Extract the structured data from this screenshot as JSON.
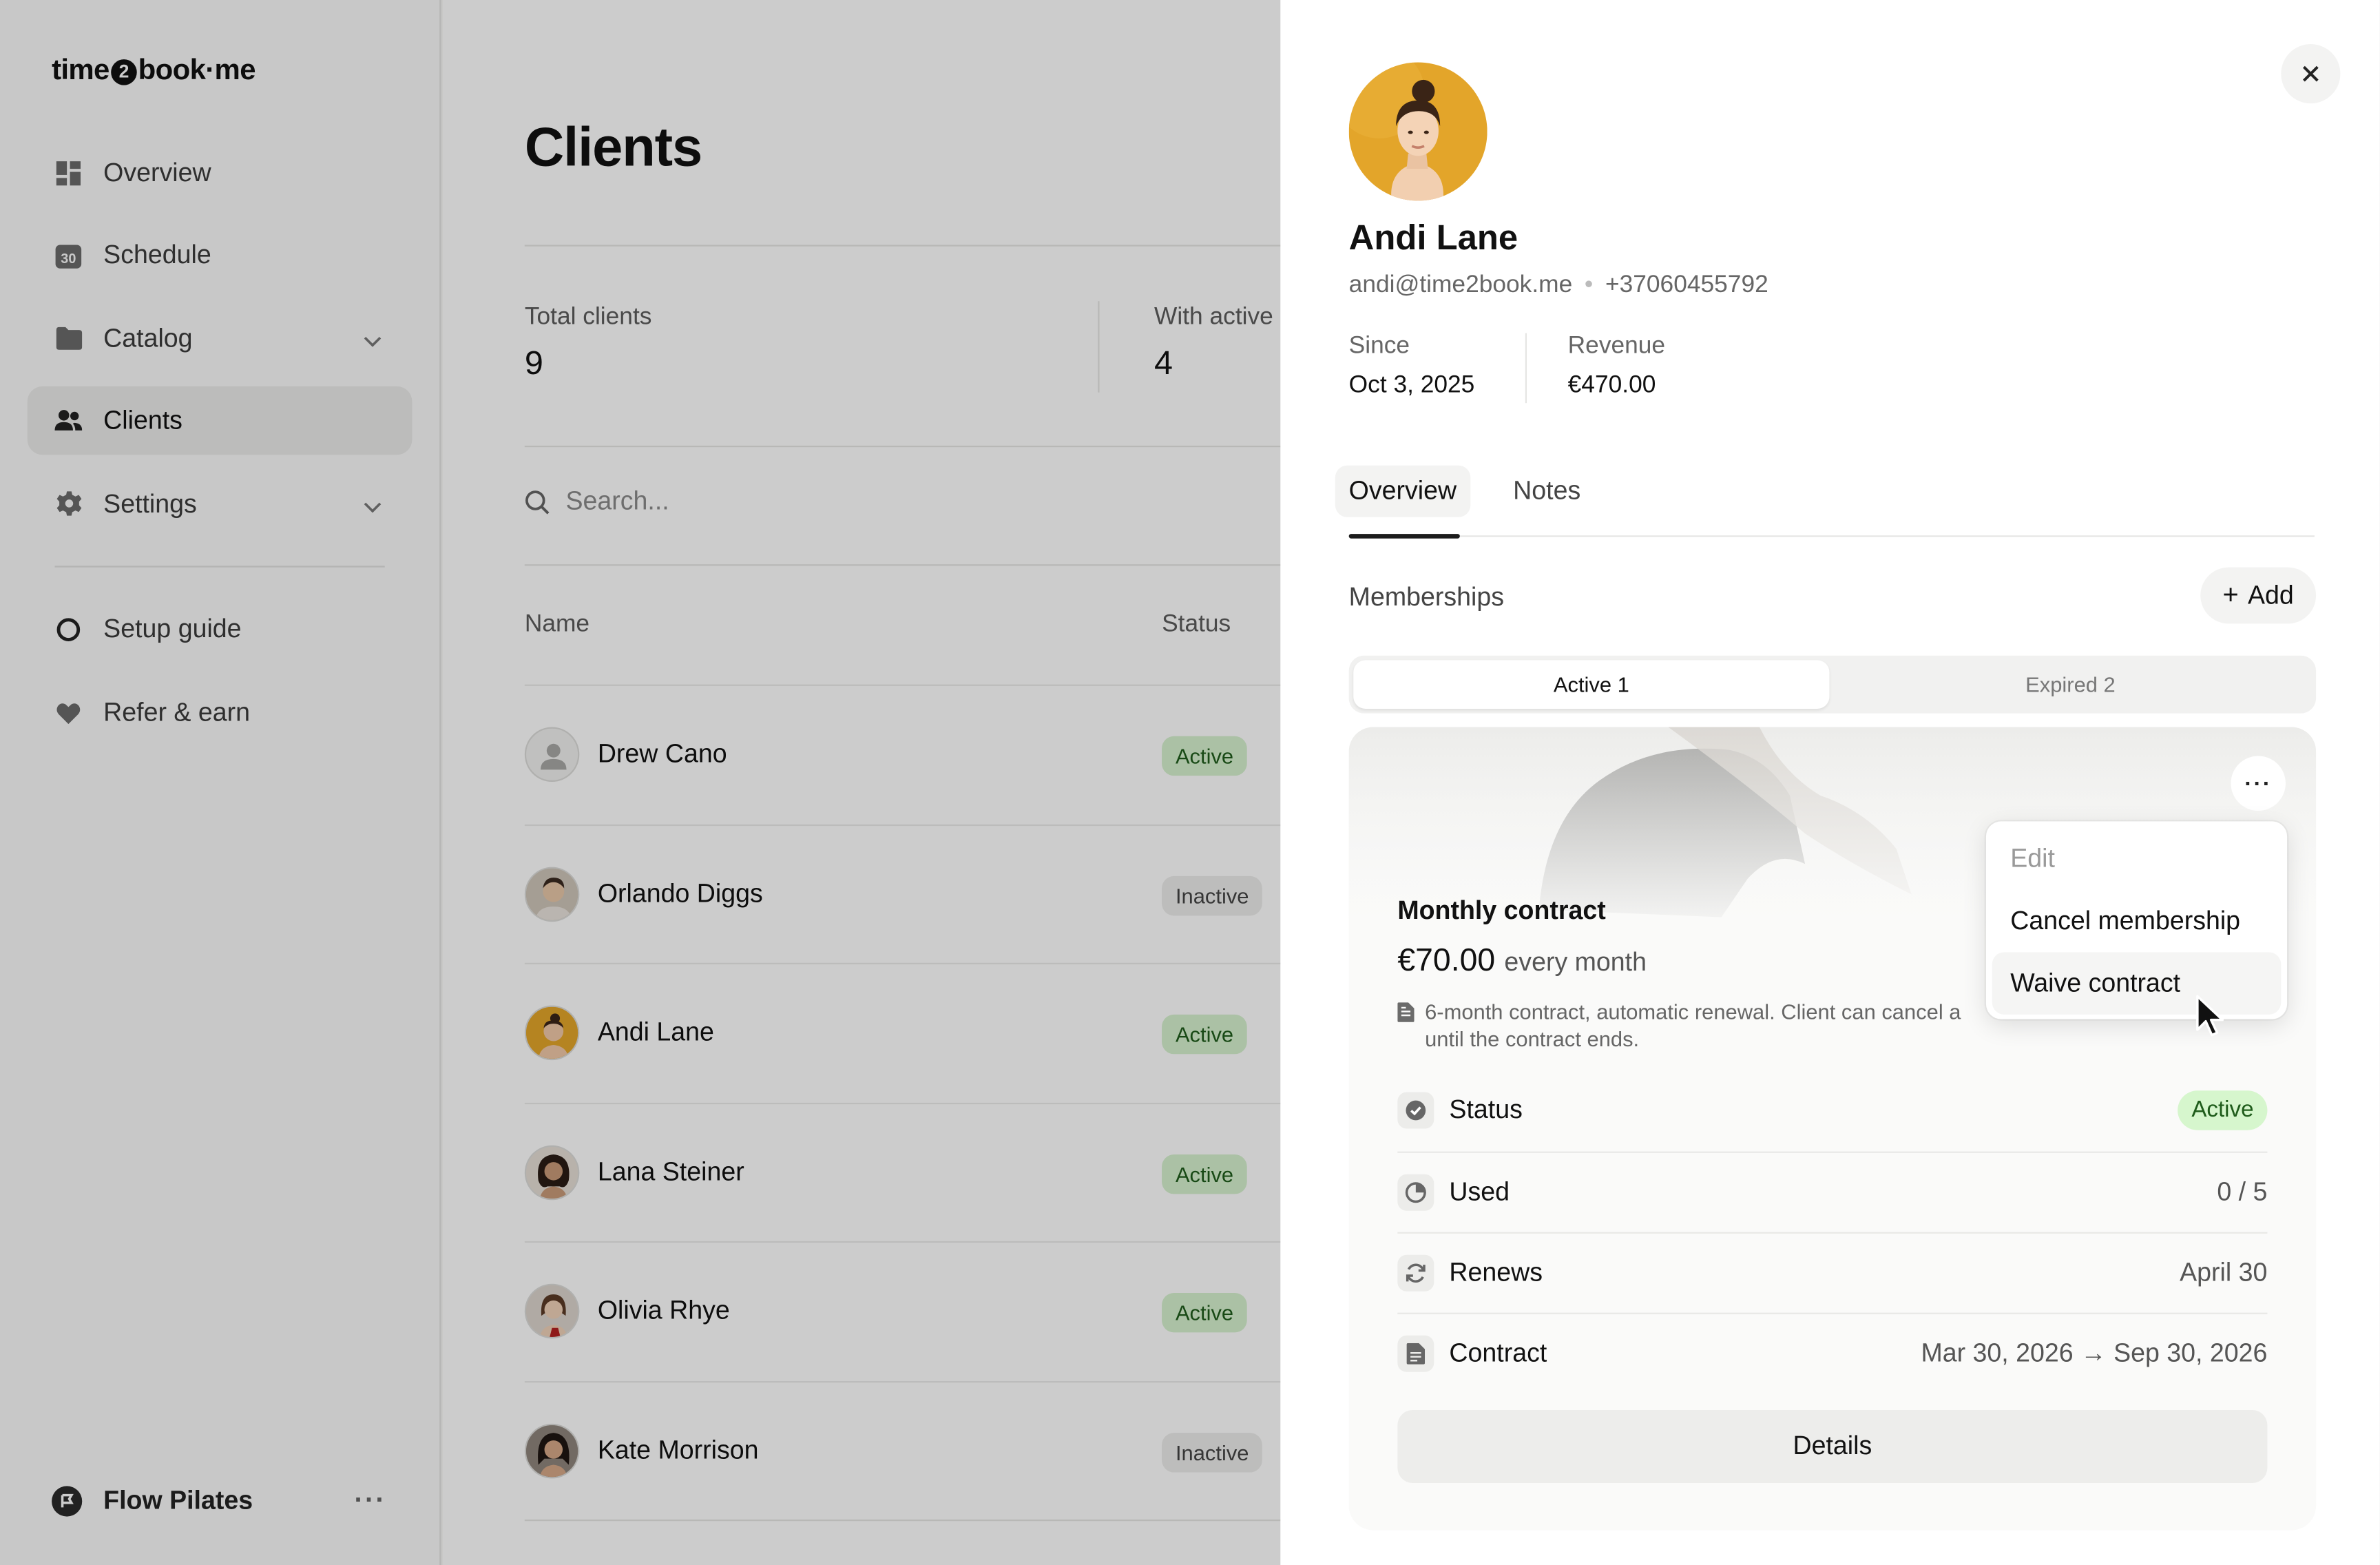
{
  "app": {
    "logo_prefix": "time",
    "logo_digit": "2",
    "logo_suffix": "book·me"
  },
  "sidebar": {
    "items": [
      {
        "label": "Overview",
        "icon": "dashboard-icon"
      },
      {
        "label": "Schedule",
        "icon": "calendar-icon",
        "icon_text": "30"
      },
      {
        "label": "Catalog",
        "icon": "folder-icon",
        "expandable": true
      },
      {
        "label": "Clients",
        "icon": "people-icon",
        "active": true
      },
      {
        "label": "Settings",
        "icon": "gear-icon",
        "expandable": true
      },
      {
        "label": "Setup guide",
        "icon": "circle-icon"
      },
      {
        "label": "Refer & earn",
        "icon": "heart-icon"
      }
    ],
    "workspace": {
      "name": "Flow Pilates",
      "more": "···"
    }
  },
  "main": {
    "title": "Clients",
    "stats": [
      {
        "label": "Total clients",
        "value": "9"
      },
      {
        "label": "With active",
        "value": "4"
      }
    ],
    "search_placeholder": "Search...",
    "columns": {
      "name": "Name",
      "status": "Status"
    },
    "rows": [
      {
        "name": "Drew Cano",
        "status": "Active"
      },
      {
        "name": "Orlando Diggs",
        "status": "Inactive"
      },
      {
        "name": "Andi Lane",
        "status": "Active"
      },
      {
        "name": "Lana Steiner",
        "status": "Active"
      },
      {
        "name": "Olivia Rhye",
        "status": "Active"
      },
      {
        "name": "Kate Morrison",
        "status": "Inactive"
      }
    ]
  },
  "drawer": {
    "close": "×",
    "client": {
      "name": "Andi Lane",
      "email": "andi@time2book.me",
      "separator": "•",
      "phone": "+37060455792",
      "since_label": "Since",
      "since_value": "Oct 3, 2025",
      "revenue_label": "Revenue",
      "revenue_value": "€470.00"
    },
    "tabs": [
      {
        "label": "Overview",
        "selected": true
      },
      {
        "label": "Notes",
        "selected": false
      }
    ],
    "memberships": {
      "title": "Memberships",
      "add_label": "Add",
      "add_icon": "+",
      "segments": [
        {
          "label": "Active 1",
          "selected": true
        },
        {
          "label": "Expired 2",
          "selected": false
        }
      ],
      "card": {
        "menu_label": "···",
        "name": "Monthly contract",
        "price": "€70.00",
        "period": "every month",
        "description": "6-month contract, automatic renewal. Client can cancel a... until the contract ends.",
        "description_line1": "6-month contract, automatic renewal. Client can cancel a",
        "description_line2": "until the contract ends.",
        "rows": [
          {
            "label": "Status",
            "value": "Active",
            "icon": "check-circle-icon"
          },
          {
            "label": "Used",
            "value": "0 / 5",
            "icon": "pie-chart-icon"
          },
          {
            "label": "Renews",
            "value": "April 30",
            "icon": "refresh-icon"
          },
          {
            "label": "Contract",
            "value": "Mar 30, 2026 → Sep 30, 2026",
            "icon": "document-icon"
          }
        ],
        "details_label": "Details"
      },
      "menu": {
        "items": [
          {
            "label": "Edit",
            "disabled": true
          },
          {
            "label": "Cancel membership",
            "disabled": false
          },
          {
            "label": "Waive contract",
            "disabled": false,
            "hovered": true
          }
        ]
      }
    }
  },
  "colors": {
    "active_badge_bg": "#d6f2cf",
    "active_badge_text": "#1f5c1b",
    "inactive_badge_bg": "#ededeb",
    "avatar_yellow": "#e3a52a"
  }
}
